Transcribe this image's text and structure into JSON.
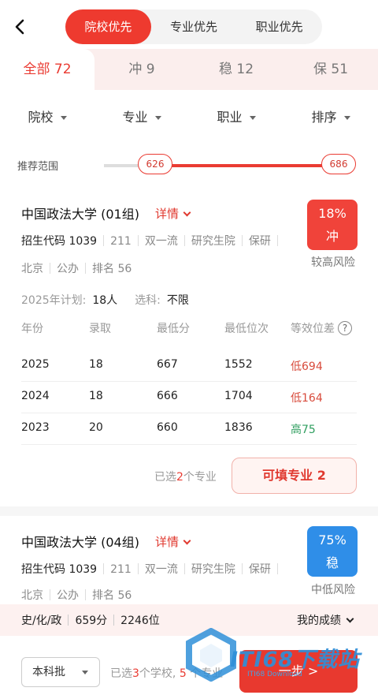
{
  "header": {
    "segments": [
      "院校优先",
      "专业优先",
      "职业优先"
    ],
    "active_segment": 0
  },
  "categories": [
    {
      "label": "全部",
      "count": "72"
    },
    {
      "label": "冲",
      "count": "9"
    },
    {
      "label": "稳",
      "count": "12"
    },
    {
      "label": "保",
      "count": "51"
    }
  ],
  "filters": [
    "院校",
    "专业",
    "职业",
    "排序"
  ],
  "range": {
    "label": "推荐范围",
    "min": "626",
    "max": "686",
    "fill_start_fraction": 0.21
  },
  "card1": {
    "title": "中国政法大学 (01组)",
    "detail": "详情",
    "code_label": "招生代码 1039",
    "tags": [
      "211",
      "双一流",
      "研究生院",
      "保研"
    ],
    "location": [
      "北京",
      "公办",
      "排名 56"
    ],
    "risk": {
      "pct": "18%",
      "level": "冲",
      "label": "较高风险",
      "color": "#f0433a"
    },
    "plan_label": "2025年计划:",
    "plan_value": "18人",
    "subject_label": "选科:",
    "subject_value": "不限",
    "table_headers": [
      "年份",
      "录取",
      "最低分",
      "最低位次",
      "等效位差"
    ],
    "rows": [
      {
        "year": "2025",
        "admit": "18",
        "min_score": "667",
        "min_rank": "1552",
        "diff": "低694",
        "diff_type": "low"
      },
      {
        "year": "2024",
        "admit": "18",
        "min_score": "666",
        "min_rank": "1704",
        "diff": "低164",
        "diff_type": "low"
      },
      {
        "year": "2023",
        "admit": "20",
        "min_score": "660",
        "min_rank": "1836",
        "diff": "高75",
        "diff_type": "high"
      }
    ],
    "selected_pre": "已选",
    "selected_count": "2",
    "selected_post": "个专业",
    "fill_button": "可填专业 2"
  },
  "card2": {
    "title": "中国政法大学 (04组)",
    "detail": "详情",
    "code_label": "招生代码 1039",
    "tags": [
      "211",
      "双一流",
      "研究生院",
      "保研"
    ],
    "location": [
      "北京",
      "公办",
      "排名 56"
    ],
    "risk": {
      "pct": "75%",
      "level": "稳",
      "label": "中低风险",
      "color": "#2f8ee8"
    }
  },
  "score_bar": {
    "subjects": "史/化/政",
    "score": "659分",
    "rank": "2246位",
    "my_score": "我的成绩"
  },
  "bottom": {
    "batch": "本科批",
    "selected_pre": "已选",
    "school_count": "3",
    "school_post": "个学校,",
    "major_count": "5",
    "major_post": "个专业",
    "next": "一步 >"
  },
  "watermark": {
    "text": "ITI68下载站",
    "sub": "ITI68 Download"
  }
}
